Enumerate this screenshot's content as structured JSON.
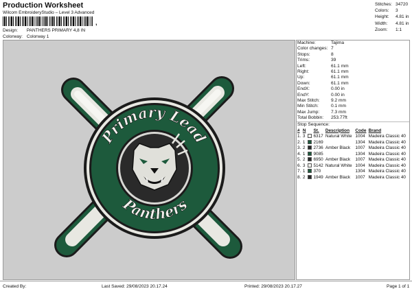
{
  "header": {
    "title": "Production Worksheet",
    "subtitle": "Wilcom EmbroideryStudio – Level 3 Advanced",
    "barcode_suffix": ",",
    "design_label": "Design:",
    "design_value": "PANTHERS PRIMARY 4,8 IN",
    "colorway_label": "Colorway:",
    "colorway_value": "Colorway 1"
  },
  "top_stats": [
    {
      "label": "Stitches:",
      "value": "34720"
    },
    {
      "label": "Colors:",
      "value": "3"
    },
    {
      "label": "Height:",
      "value": "4.81 in"
    },
    {
      "label": "Width:",
      "value": "4.81 in"
    },
    {
      "label": "Zoom:",
      "value": "1:1"
    }
  ],
  "design_text": {
    "top": "Primary Lead",
    "bottom": "Panthers"
  },
  "machine_info": [
    {
      "label": "Machine:",
      "value": "Tajima"
    },
    {
      "label": "Color changes:",
      "value": "7"
    },
    {
      "label": "Stops:",
      "value": "8"
    },
    {
      "label": "Trims:",
      "value": "39"
    },
    {
      "label": "Left:",
      "value": "61.1 mm"
    },
    {
      "label": "Right:",
      "value": "61.1 mm"
    },
    {
      "label": "Up:",
      "value": "61.1 mm"
    },
    {
      "label": "Down:",
      "value": "61.1 mm"
    },
    {
      "label": "EndX:",
      "value": "0.00 in"
    },
    {
      "label": "EndY:",
      "value": "0.00 in"
    },
    {
      "label": "Max Stitch:",
      "value": "9.2 mm"
    },
    {
      "label": "Min Stitch:",
      "value": "0.1 mm"
    },
    {
      "label": "Max Jump:",
      "value": "7.3 mm"
    },
    {
      "label": "Total Bobbin:",
      "value": "253.77ft"
    }
  ],
  "stop_sequence": {
    "title": "Stop Sequence:",
    "columns": [
      "#",
      "N",
      "St.",
      "Description",
      "Code",
      "Brand"
    ],
    "rows": [
      {
        "num": "1.",
        "n": "3",
        "color": "#f0f0ec",
        "st": "6317",
        "desc": "Natural White",
        "code": "1004",
        "brand": "Madeira Classic 40"
      },
      {
        "num": "2.",
        "n": "1",
        "color": "#1d5a3c",
        "st": "2169",
        "desc": "",
        "code": "1304",
        "brand": "Madeira Classic 40"
      },
      {
        "num": "3.",
        "n": "2",
        "color": "#2a2a2a",
        "st": "2736",
        "desc": "Amber Black",
        "code": "1007",
        "brand": "Madeira Classic 40"
      },
      {
        "num": "4.",
        "n": "1",
        "color": "#1d5a3c",
        "st": "9085",
        "desc": "",
        "code": "1304",
        "brand": "Madeira Classic 40"
      },
      {
        "num": "5.",
        "n": "2",
        "color": "#2a2a2a",
        "st": "6950",
        "desc": "Amber Black",
        "code": "1007",
        "brand": "Madeira Classic 40"
      },
      {
        "num": "6.",
        "n": "3",
        "color": "#f0f0ec",
        "st": "5142",
        "desc": "Natural White",
        "code": "1004",
        "brand": "Madeira Classic 40"
      },
      {
        "num": "7.",
        "n": "1",
        "color": "#1d5a3c",
        "st": "370",
        "desc": "",
        "code": "1304",
        "brand": "Madeira Classic 40"
      },
      {
        "num": "8.",
        "n": "2",
        "color": "#2a2a2a",
        "st": "1949",
        "desc": "Amber Black",
        "code": "1007",
        "brand": "Madeira Classic 40"
      }
    ]
  },
  "footer": {
    "created_by": "Created By:",
    "last_saved": "Last Saved: 29/08/2023 20.17.24",
    "printed": "Printed: 29/08/2023 20.17.27",
    "page": "Page 1 of 1"
  },
  "colors": {
    "green": "#1d5a3c",
    "black": "#2a2a2a",
    "white": "#f0f0ec",
    "canvas": "#cccccc"
  }
}
